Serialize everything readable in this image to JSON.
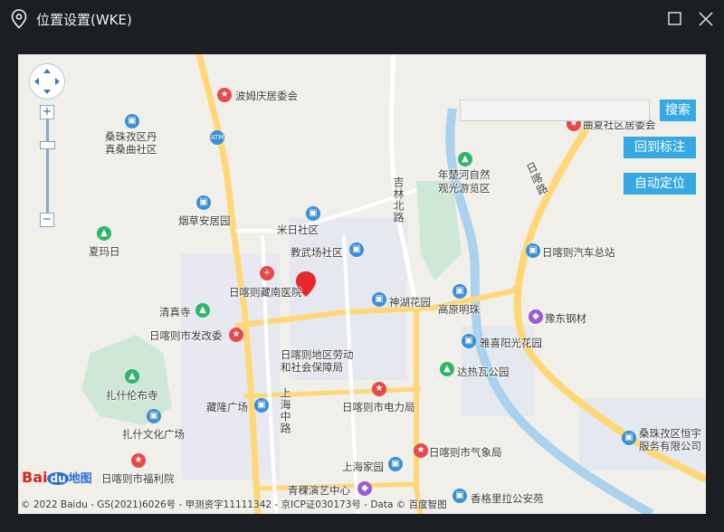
{
  "window": {
    "title": "位置设置(WKE)",
    "minimize_icon": "maximize-icon",
    "close_icon": "close-icon"
  },
  "map": {
    "search": {
      "placeholder": "",
      "value": "",
      "button": "搜索"
    },
    "buttons": {
      "back_to_mark": "回到标注",
      "auto_locate": "自动定位"
    },
    "zoom": {
      "plus": "+",
      "minus": "−"
    },
    "roads": {
      "jilin_north": "吉林北路",
      "shanghai_middle": "上海中路",
      "ri_kaze": "日喀路"
    },
    "pois": [
      {
        "id": "bomuqing",
        "label": "波姆庆居委会",
        "color": "red"
      },
      {
        "id": "sangzhu_danzhen",
        "label": "桑珠孜区丹\n真桑曲社区",
        "color": "blue"
      },
      {
        "id": "atm",
        "label": "ATM",
        "color": "blue"
      },
      {
        "id": "xiamaori",
        "label": "夏玛日",
        "color": "green"
      },
      {
        "id": "yancao",
        "label": "烟草安居园",
        "color": "blue"
      },
      {
        "id": "miri",
        "label": "米日社区",
        "color": "blue"
      },
      {
        "id": "jiaowuchang",
        "label": "教武场社区",
        "color": "blue"
      },
      {
        "id": "zangnan_hospital",
        "label": "日喀则藏南医院",
        "color": "red"
      },
      {
        "id": "qingzhensi",
        "label": "清真寺",
        "color": "green"
      },
      {
        "id": "fagaiwei",
        "label": "日喀则市发改委",
        "color": "red"
      },
      {
        "id": "shenhu",
        "label": "神湖花园",
        "color": "blue"
      },
      {
        "id": "gaoyuan",
        "label": "高原明珠",
        "color": "blue"
      },
      {
        "id": "yudong",
        "label": "豫东钢材",
        "color": "purple"
      },
      {
        "id": "yaxi",
        "label": "雅喜阳光花园",
        "color": "blue"
      },
      {
        "id": "laodong",
        "label": "日喀则地区劳动\n和社会保障局",
        "color": "red"
      },
      {
        "id": "dare",
        "label": "达热瓦公园",
        "color": "green"
      },
      {
        "id": "zhashi_temple",
        "label": "扎什伦布寺",
        "color": "green"
      },
      {
        "id": "zanglong",
        "label": "藏隆广场",
        "color": "blue"
      },
      {
        "id": "dianli",
        "label": "日喀则市电力局",
        "color": "red"
      },
      {
        "id": "zhashi_culture",
        "label": "扎什文化广场",
        "color": "blue"
      },
      {
        "id": "qixiang",
        "label": "日喀则市气象局",
        "color": "red"
      },
      {
        "id": "fuli",
        "label": "日喀则市福利院",
        "color": "red"
      },
      {
        "id": "shanghai_home",
        "label": "上海家园",
        "color": "blue"
      },
      {
        "id": "qingke",
        "label": "青稞演艺中心",
        "color": "purple"
      },
      {
        "id": "xianggelila",
        "label": "香格里拉公安苑",
        "color": "blue"
      },
      {
        "id": "nianchu",
        "label": "年楚河自然\n观光游览区",
        "color": "green"
      },
      {
        "id": "bus_station",
        "label": "日喀则汽车总站",
        "color": "blue"
      },
      {
        "id": "sangzhu_heng",
        "label": "桑珠孜区恒宇\n服务有限公司",
        "color": "blue"
      },
      {
        "id": "quxia",
        "label": "曲夏社区居委会",
        "color": "red"
      }
    ],
    "copyright": "© 2022 Baidu - GS(2021)6026号 - 甲测资字11111342 - 京ICP证030173号 - Data © 百度智图",
    "logo": {
      "bai": "Bai",
      "du": "du",
      "ditu": "地图"
    }
  }
}
